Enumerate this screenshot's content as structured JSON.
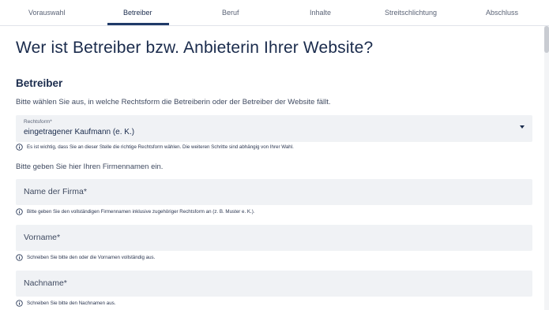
{
  "tabs": [
    {
      "label": "Vorauswahl"
    },
    {
      "label": "Betreiber"
    },
    {
      "label": "Beruf"
    },
    {
      "label": "Inhalte"
    },
    {
      "label": "Streitschlichtung"
    },
    {
      "label": "Abschluss"
    }
  ],
  "page_title": "Wer ist Betreiber bzw. Anbieterin Ihrer Website?",
  "section": {
    "title": "Betreiber",
    "description": "Bitte wählen Sie aus, in welche Rechtsform die Betreiberin oder der Betreiber der Website fällt."
  },
  "rechtsform": {
    "label": "Rechtsform*",
    "value": "eingetragener Kaufmann (e. K.)",
    "hint": "Es ist wichtig, dass Sie an dieser Stelle die richtige Rechtsform wählen. Die weiteren Schritte sind abhängig von Ihrer Wahl."
  },
  "firmenname_desc": "Bitte geben Sie hier Ihren Firmennamen ein.",
  "fields": {
    "firma": {
      "placeholder": "Name der Firma*",
      "hint": "Bitte geben Sie den vollständigen Firmennamen inklusive zugehöriger Rechtsform an (z. B. Muster e. K.)."
    },
    "vorname": {
      "placeholder": "Vorname*",
      "hint": "Schreiben Sie bitte den oder die Vornamen vollständig aus."
    },
    "nachname": {
      "placeholder": "Nachname*",
      "hint": "Schreiben Sie bitte den Nachnamen aus."
    }
  },
  "icons": {
    "hint": "info-icon",
    "select": "caret-down-icon"
  },
  "colors": {
    "text": "#1a2b4c",
    "field_bg": "#f0f2f5",
    "active_tab": "#1f3a68"
  }
}
